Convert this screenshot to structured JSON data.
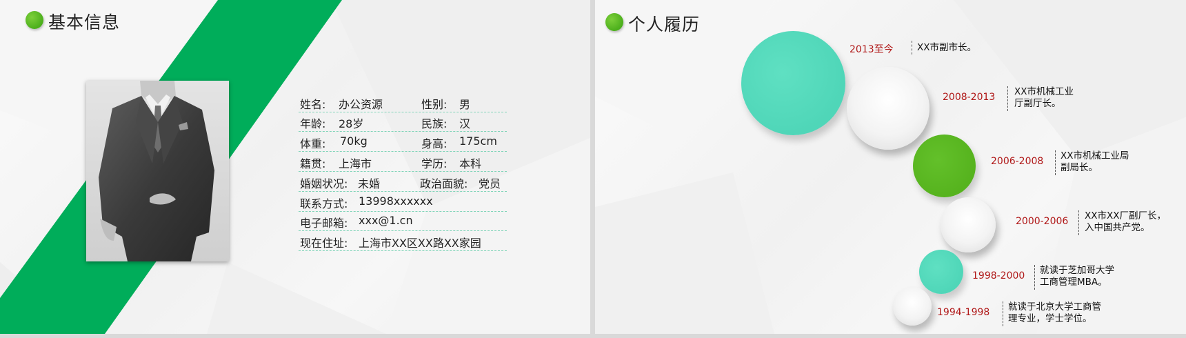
{
  "left_slide": {
    "title": "基本信息",
    "info": [
      {
        "label1": "姓名:",
        "value1": "办公资源",
        "label2": "性别:",
        "value2": "男"
      },
      {
        "label1": "年龄:",
        "value1": "28岁",
        "label2": "民族:",
        "value2": "汉"
      },
      {
        "label1": "体重:",
        "value1": "70kg",
        "label2": "身高:",
        "value2": "175cm"
      },
      {
        "label1": "籍贯:",
        "value1": "上海市",
        "label2": "学历:",
        "value2": "本科"
      },
      {
        "label1": "婚姻状况:",
        "value1": "未婚",
        "label2": "政治面貌:",
        "value2": "党员"
      },
      {
        "label1": "联系方式:",
        "value1": "13998xxxxxx"
      },
      {
        "label1": "电子邮箱:",
        "value1": "xxx@1.cn"
      },
      {
        "label1": "现在住址:",
        "value1": "上海市XX区XX路XX家园"
      }
    ],
    "colors": {
      "accent_green": "#00ad5a",
      "bullet_green": "#5cb82a",
      "divider": "#7fd4b8"
    }
  },
  "right_slide": {
    "title": "个人履历",
    "timeline": [
      {
        "year": "2013至今",
        "desc": [
          "XX市副市长。"
        ]
      },
      {
        "year": "2008-2013",
        "desc": [
          "XX市机械工业",
          "厅副厅长。"
        ]
      },
      {
        "year": "2006-2008",
        "desc": [
          "XX市机械工业局",
          "副局长。"
        ]
      },
      {
        "year": "2000-2006",
        "desc": [
          "XX市XX厂副厂长，",
          "入中国共产党。"
        ]
      },
      {
        "year": "1998-2000",
        "desc": [
          "就读于芝加哥大学",
          "工商管理MBA。"
        ]
      },
      {
        "year": "1994-1998",
        "desc": [
          "就读于北京大学工商管",
          "理专业，学士学位。"
        ]
      }
    ],
    "colors": {
      "teal": "#4fd6b8",
      "green": "#56b31e",
      "year_red": "#b01818"
    }
  }
}
